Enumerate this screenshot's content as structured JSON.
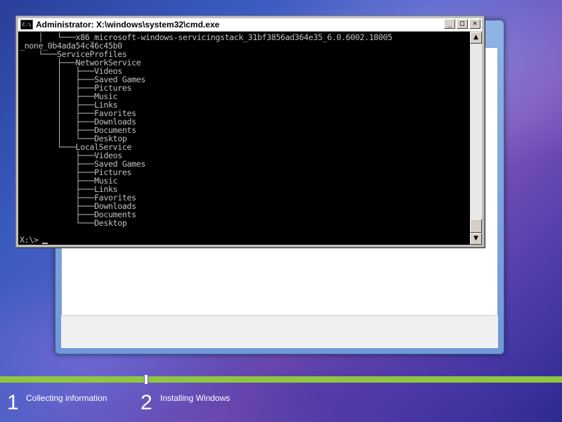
{
  "desktop": {
    "accent_green": "#8fc63f",
    "track_color": "#7f8ed0"
  },
  "cmd": {
    "title": "Administrator: X:\\windows\\system32\\cmd.exe",
    "icon_text": "C:\\",
    "buttons": {
      "minimize": "_",
      "maximize": "□",
      "close": "✕"
    },
    "lines": [
      "    │   └───x86_microsoft-windows-servicingstack_31bf3856ad364e35_6.0.6002.18005",
      "_none_0b4ada54c46c45b0",
      "    └───ServiceProfiles",
      "        ├───NetworkService",
      "        │   ├───Videos",
      "        │   ├───Saved Games",
      "        │   ├───Pictures",
      "        │   ├───Music",
      "        │   ├───Links",
      "        │   ├───Favorites",
      "        │   ├───Downloads",
      "        │   ├───Documents",
      "        │   └───Desktop",
      "        └───LocalService",
      "            ├───Videos",
      "            ├───Saved Games",
      "            ├───Pictures",
      "            ├───Music",
      "            ├───Links",
      "            ├───Favorites",
      "            ├───Downloads",
      "            ├───Documents",
      "            └───Desktop"
    ],
    "prompt": "X:\\>"
  },
  "setup": {
    "steps": [
      {
        "number": "1",
        "label": "Collecting information"
      },
      {
        "number": "2",
        "label": "Installing Windows"
      }
    ],
    "progress": [
      {
        "step": "Collecting information",
        "fraction": 1.0
      },
      {
        "step": "Installing Windows",
        "fraction": 1.0
      }
    ]
  }
}
